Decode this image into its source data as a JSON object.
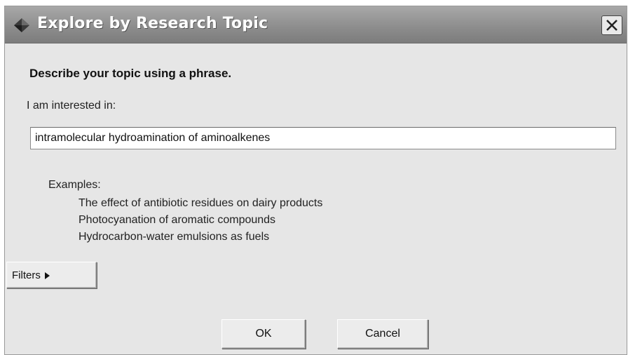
{
  "window": {
    "title": "Explore by Research Topic",
    "app_icon": "diamond-app-icon",
    "close_icon": "close-icon"
  },
  "form": {
    "heading": "Describe your topic using a phrase.",
    "prompt": "I am interested in:",
    "topic_value": "intramolecular hydroamination of aminoalkenes",
    "topic_placeholder": ""
  },
  "examples": {
    "label": "Examples:",
    "items": [
      "The effect of antibiotic residues on dairy products",
      "Photocyanation of aromatic compounds",
      "Hydrocarbon-water emulsions as fuels"
    ]
  },
  "buttons": {
    "filters_label": "Filters",
    "filters_icon": "triangle-right-icon",
    "ok_label": "OK",
    "cancel_label": "Cancel"
  },
  "colors": {
    "titlebar": "#8e8e8e",
    "dialog_background": "#e6e6e6",
    "title_text": "#ffffff"
  }
}
